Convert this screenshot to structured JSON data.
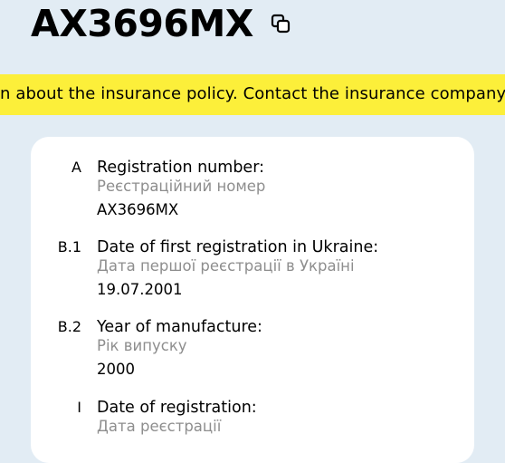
{
  "header": {
    "plate_number": "AX3696MX",
    "copy_icon": "copy-icon"
  },
  "banner": {
    "text": "n about the insurance policy. Contact the insurance company",
    "color": "#fcef3a"
  },
  "fields": [
    {
      "code": "A",
      "label": "Registration number:",
      "sublabel": "Реєстраційний номер",
      "value": "AX3696MX"
    },
    {
      "code": "B.1",
      "label": "Date of first registration in Ukraine:",
      "sublabel": "Дата першої реєстрації в Україні",
      "value": "19.07.2001"
    },
    {
      "code": "B.2",
      "label": "Year of manufacture:",
      "sublabel": "Рік випуску",
      "value": "2000"
    },
    {
      "code": "I",
      "label": "Date of registration:",
      "sublabel": "Дата реєстрації",
      "value": ""
    }
  ],
  "colors": {
    "background": "#e2ecf4",
    "card": "#ffffff",
    "sublabel": "#8e8e8e"
  }
}
